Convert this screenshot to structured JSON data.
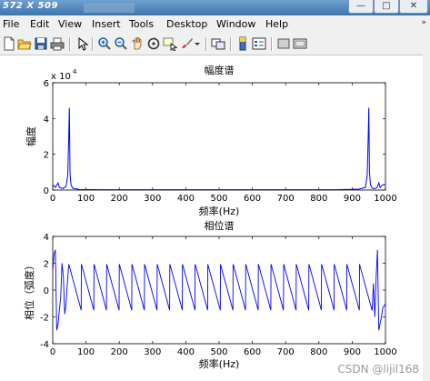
{
  "window": {
    "size_label": "572 X 509",
    "minimize_glyph": "—",
    "maximize_glyph": "□",
    "close_glyph": "✕"
  },
  "menu": {
    "items": [
      "File",
      "Edit",
      "View",
      "Insert",
      "Tools",
      "Desktop",
      "Window",
      "Help"
    ],
    "overflow_glyph": "»"
  },
  "toolbar": {
    "icons": [
      "new-figure-icon",
      "open-file-icon",
      "save-icon",
      "print-icon",
      "pointer-icon",
      "zoom-in-icon",
      "zoom-out-icon",
      "pan-icon",
      "rotate-3d-icon",
      "data-cursor-icon",
      "brush-icon",
      "link-plot-icon",
      "colorbar-icon",
      "legend-icon",
      "hide-plot-tools-icon",
      "show-plot-tools-icon"
    ]
  },
  "watermark": "CSDN @lijil168",
  "chart_data": [
    {
      "type": "line",
      "title": "幅度谱",
      "xlabel": "频率(Hz)",
      "ylabel": "幅度",
      "y_exponent_label": "x 10",
      "y_exponent": "4",
      "xlim": [
        0,
        1000
      ],
      "ylim": [
        0,
        6
      ],
      "xticks": [
        0,
        100,
        200,
        300,
        400,
        500,
        600,
        700,
        800,
        900,
        1000
      ],
      "yticks": [
        0,
        2,
        4,
        6
      ],
      "line_color": "#0000ff",
      "series": [
        {
          "x": [
            0,
            8,
            16,
            20,
            30,
            40,
            45,
            48,
            50,
            52,
            55,
            60,
            80,
            150,
            300,
            500,
            700,
            850,
            920,
            940,
            945,
            948,
            950,
            952,
            955,
            960,
            970,
            975,
            980,
            984,
            992,
            1000
          ],
          "y": [
            0.3,
            0.15,
            0.4,
            0.15,
            0.08,
            0.2,
            0.8,
            2.9,
            4.6,
            1.0,
            0.3,
            0.1,
            0.03,
            0.02,
            0.02,
            0.02,
            0.02,
            0.02,
            0.05,
            0.15,
            0.8,
            2.9,
            4.6,
            1.0,
            0.3,
            0.1,
            0.08,
            0.15,
            0.4,
            0.15,
            0.3,
            0.3
          ]
        }
      ]
    },
    {
      "type": "line",
      "title": "相位谱",
      "xlabel": "频率(Hz)",
      "ylabel": "相位（弧度）",
      "xlim": [
        0,
        1000
      ],
      "ylim": [
        -4,
        4
      ],
      "xticks": [
        0,
        100,
        200,
        300,
        400,
        500,
        600,
        700,
        800,
        900,
        1000
      ],
      "yticks": [
        -4,
        -2,
        0,
        2,
        4
      ],
      "line_color": "#0000ff",
      "sawtooth": {
        "start_x": 48,
        "end_x": 960,
        "period_hz": 38,
        "high": 1.9,
        "low": -1.5
      },
      "edge_segments_left": {
        "x": [
          0,
          4,
          8,
          12,
          16,
          20,
          24,
          28,
          32,
          36,
          40,
          44,
          48
        ],
        "y": [
          1.5,
          2.7,
          3.0,
          -3.0,
          -2.5,
          -1.5,
          -0.5,
          2.0,
          1.0,
          -1.8,
          -1.0,
          0.5,
          1.9
        ]
      },
      "edge_segments_right": {
        "x": [
          960,
          964,
          968,
          972,
          976,
          980,
          984,
          988,
          992,
          996,
          1000
        ],
        "y": [
          -1.5,
          0.5,
          -2.0,
          1.0,
          3.0,
          -3.0,
          -2.5,
          -2.0,
          -1.3,
          -1.2,
          -1.0
        ]
      }
    }
  ]
}
